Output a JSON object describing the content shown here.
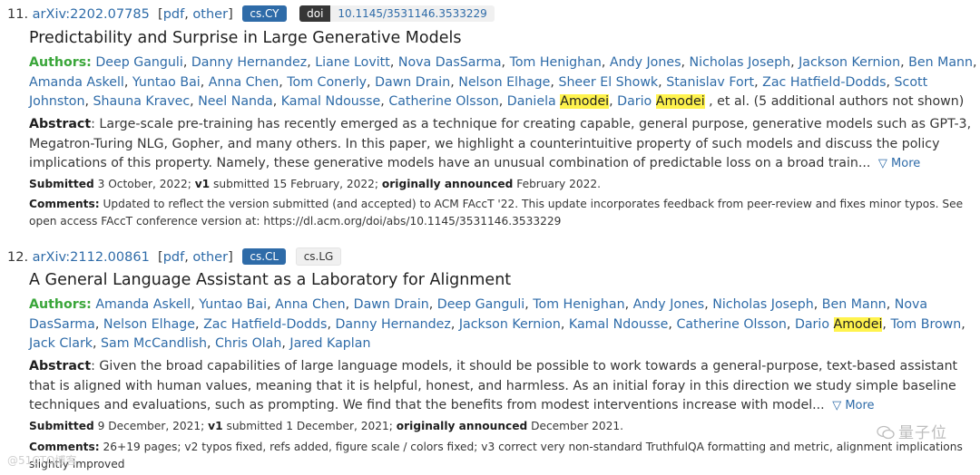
{
  "entries": [
    {
      "number": "11.",
      "arxiv_id": "arXiv:2202.07785",
      "links": [
        "pdf",
        "other"
      ],
      "tags": [
        "cs.CY"
      ],
      "doi_label": "doi",
      "doi": "10.1145/3531146.3533229",
      "title": "Predictability and Surprise in Large Generative Models",
      "authors_label": "Authors:",
      "authors": [
        "Deep Ganguli",
        "Danny Hernandez",
        "Liane Lovitt",
        "Nova DasSarma",
        "Tom Henighan",
        "Andy Jones",
        "Nicholas Joseph",
        "Jackson Kernion",
        "Ben Mann",
        "Amanda Askell",
        "Yuntao Bai",
        "Anna Chen",
        "Tom Conerly",
        "Dawn Drain",
        "Nelson Elhage",
        "Sheer El Showk",
        "Stanislav Fort",
        "Zac Hatfield-Dodds",
        "Scott Johnston",
        "Shauna Kravec",
        "Neel Nanda",
        "Kamal Ndousse",
        "Catherine Olsson",
        "Daniela Amodei",
        "Dario Amodei"
      ],
      "authors_suffix": ", et al. (5 additional authors not shown)",
      "abstract_label": "Abstract",
      "abstract": ": Large-scale pre-training has recently emerged as a technique for creating capable, general purpose, generative models such as GPT-3, Megatron-Turing NLG, Gopher, and many others. In this paper, we highlight a counterintuitive property of such models and discuss the policy implications of this property. Namely, these generative models have an unusual combination of predictable loss on a broad train...",
      "more": "▽ More",
      "submitted_label": "Submitted",
      "submitted": "3 October, 2022;",
      "v1_label": "v1",
      "v1": "submitted 15 February, 2022;",
      "announced_label": "originally announced",
      "announced": "February 2022.",
      "comments_label": "Comments:",
      "comments": "Updated to reflect the version submitted (and accepted) to ACM FAccT '22. This update incorporates feedback from peer-review and fixes minor typos. See open access FAccT conference version at: https://dl.acm.org/doi/abs/10.1145/3531146.3533229"
    },
    {
      "number": "12.",
      "arxiv_id": "arXiv:2112.00861",
      "links": [
        "pdf",
        "other"
      ],
      "tags": [
        "cs.CL",
        "cs.LG"
      ],
      "title": "A General Language Assistant as a Laboratory for Alignment",
      "authors_label": "Authors:",
      "authors": [
        "Amanda Askell",
        "Yuntao Bai",
        "Anna Chen",
        "Dawn Drain",
        "Deep Ganguli",
        "Tom Henighan",
        "Andy Jones",
        "Nicholas Joseph",
        "Ben Mann",
        "Nova DasSarma",
        "Nelson Elhage",
        "Zac Hatfield-Dodds",
        "Danny Hernandez",
        "Jackson Kernion",
        "Kamal Ndousse",
        "Catherine Olsson",
        "Dario Amodei",
        "Tom Brown",
        "Jack Clark",
        "Sam McCandlish",
        "Chris Olah",
        "Jared Kaplan"
      ],
      "authors_suffix": "",
      "abstract_label": "Abstract",
      "abstract": ": Given the broad capabilities of large language models, it should be possible to work towards a general-purpose, text-based assistant that is aligned with human values, meaning that it is helpful, honest, and harmless. As an initial foray in this direction we study simple baseline techniques and evaluations, such as prompting. We find that the benefits from modest interventions increase with model...",
      "more": "▽ More",
      "submitted_label": "Submitted",
      "submitted": "9 December, 2021;",
      "v1_label": "v1",
      "v1": "submitted 1 December, 2021;",
      "announced_label": "originally announced",
      "announced": "December 2021.",
      "comments_label": "Comments:",
      "comments": "26+19 pages; v2 typos fixed, refs added, figure scale / colors fixed; v3 correct very non-standard TruthfulQA formatting and metric, alignment implications slightly improved"
    }
  ],
  "highlight_term": "Amodei",
  "watermark_right": "量子位",
  "watermark_left": "@51CTO博客",
  "colors": {
    "link": "#2e6ba8",
    "authors_label": "#3aa63a",
    "highlight": "#fff34d"
  }
}
